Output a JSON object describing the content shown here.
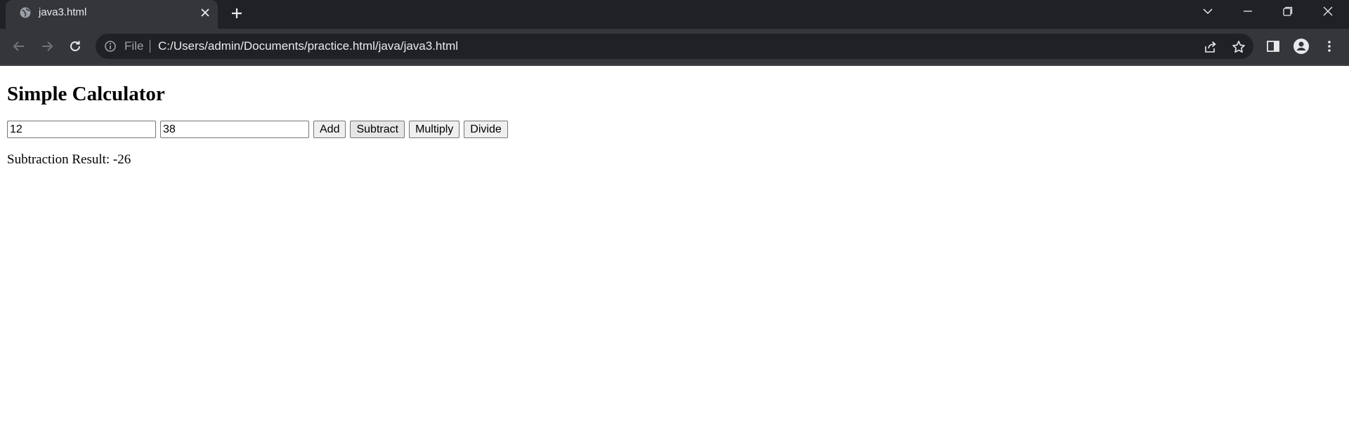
{
  "browser": {
    "tab": {
      "title": "java3.html",
      "favicon": "globe-icon"
    },
    "new_tab_icon": "plus-icon",
    "window_controls": [
      "chevron-down-icon",
      "minimize-icon",
      "restore-icon",
      "close-icon"
    ],
    "address_bar": {
      "scheme_label": "File",
      "url": "C:/Users/admin/Documents/practice.html/java/java3.html"
    },
    "theme": {
      "frame": "#202124",
      "toolbar": "#35363a",
      "omnibox": "#202124",
      "text": "#e8eaed"
    }
  },
  "page": {
    "heading": "Simple Calculator",
    "inputs": {
      "first_value": "12",
      "second_value": "38"
    },
    "buttons": {
      "add": "Add",
      "subtract": "Subtract",
      "multiply": "Multiply",
      "divide": "Divide"
    },
    "result_text": "Subtraction Result: -26"
  }
}
